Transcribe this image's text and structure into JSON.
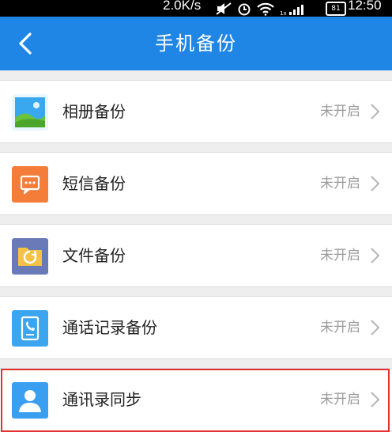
{
  "status_bar": {
    "speed": "2.0K/s",
    "battery": "81",
    "time": "12:50"
  },
  "header": {
    "title": "手机备份",
    "back_icon": "chevron-left-icon"
  },
  "items": [
    {
      "label": "相册备份",
      "status": "未开启",
      "icon": "photo-album-icon"
    },
    {
      "label": "短信备份",
      "status": "未开启",
      "icon": "sms-icon"
    },
    {
      "label": "文件备份",
      "status": "未开启",
      "icon": "folder-sync-icon"
    },
    {
      "label": "通话记录备份",
      "status": "未开启",
      "icon": "call-log-icon"
    },
    {
      "label": "通讯录同步",
      "status": "未开启",
      "icon": "contacts-icon"
    }
  ],
  "colors": {
    "header": "#1f86e6",
    "highlight_border": "#e53030",
    "status_text": "#9a9a9a"
  }
}
